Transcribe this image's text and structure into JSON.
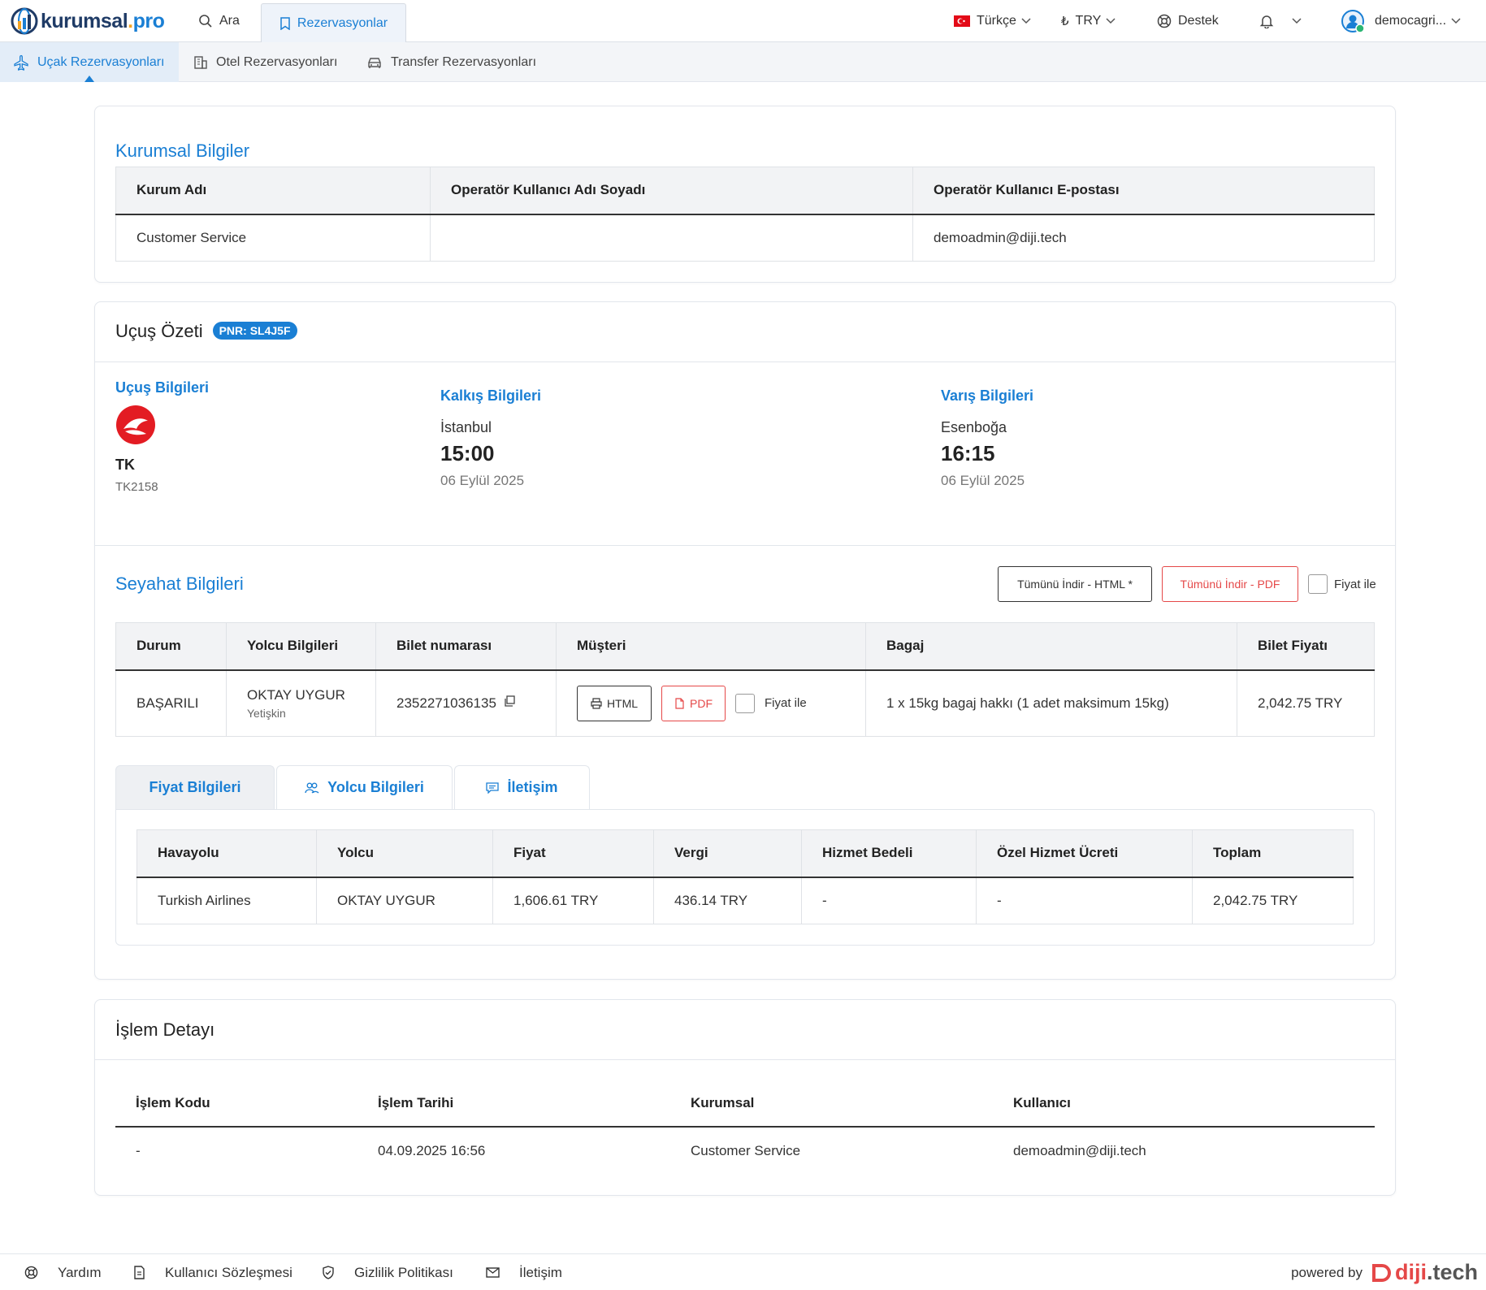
{
  "brand": {
    "name_part1": "kurumsal",
    "name_dot": ".",
    "name_part2": "pro"
  },
  "topnav": {
    "search_label": "Ara",
    "reservations_label": "Rezervasyonlar",
    "language_label": "Türkçe",
    "currency_symbol": "₺",
    "currency_label": "TRY",
    "support_label": "Destek",
    "user_label": "democagri..."
  },
  "subnav": {
    "flight": "Uçak Rezervasyonları",
    "hotel": "Otel Rezervasyonları",
    "transfer": "Transfer Rezervasyonları"
  },
  "corporate": {
    "title": "Kurumsal Bilgiler",
    "headers": [
      "Kurum Adı",
      "Operatör Kullanıcı Adı Soyadı",
      "Operatör Kullanıcı E-postası"
    ],
    "row": [
      "Customer Service",
      "",
      "demoadmin@diji.tech"
    ]
  },
  "flight_summary": {
    "title": "Uçuş Özeti",
    "pnr": "PNR: SL4J5F",
    "flight_info_label": "Uçuş Bilgileri",
    "airline_code": "TK",
    "flight_number": "TK2158",
    "departure": {
      "label": "Kalkış Bilgileri",
      "city": "İstanbul",
      "time": "15:00",
      "date": "06 Eylül 2025"
    },
    "arrival": {
      "label": "Varış Bilgileri",
      "city": "Esenboğa",
      "time": "16:15",
      "date": "06 Eylül 2025"
    }
  },
  "travel": {
    "title": "Seyahat Bilgileri",
    "download_html": "Tümünü İndir - HTML *",
    "download_pdf": "Tümünü İndir - PDF",
    "with_price": "Fiyat ile",
    "headers": [
      "Durum",
      "Yolcu Bilgileri",
      "Bilet numarası",
      "Müşteri",
      "Bagaj",
      "Bilet Fiyatı"
    ],
    "row": {
      "status": "BAŞARILI",
      "passenger": "OKTAY UYGUR",
      "passenger_type": "Yetişkin",
      "ticket_no": "2352271036135",
      "btn_html": "HTML",
      "btn_pdf": "PDF",
      "with_price": "Fiyat ile",
      "baggage": "1 x 15kg bagaj hakkı (1 adet maksimum 15kg)",
      "price": "2,042.75 TRY"
    }
  },
  "tabs": {
    "price": "Fiyat Bilgileri",
    "passenger": "Yolcu Bilgileri",
    "contact": "İletişim"
  },
  "price_table": {
    "headers": [
      "Havayolu",
      "Yolcu",
      "Fiyat",
      "Vergi",
      "Hizmet Bedeli",
      "Özel Hizmet Ücreti",
      "Toplam"
    ],
    "row": [
      "Turkish Airlines",
      "OKTAY UYGUR",
      "1,606.61 TRY",
      "436.14 TRY",
      "-",
      "-",
      "2,042.75 TRY"
    ]
  },
  "transaction": {
    "title": "İşlem Detayı",
    "headers": [
      "İşlem Kodu",
      "İşlem Tarihi",
      "Kurumsal",
      "Kullanıcı"
    ],
    "row": [
      "-",
      "04.09.2025 16:56",
      "Customer Service",
      "demoadmin@diji.tech"
    ]
  },
  "footer": {
    "help": "Yardım",
    "terms": "Kullanıcı Sözleşmesi",
    "privacy": "Gizlilik Politikası",
    "contact": "İletişim",
    "powered_by": "powered by",
    "powered_brand_main": "diji",
    "powered_brand_tail": ".tech"
  },
  "colors": {
    "accent": "#1a7fd4",
    "danger": "#e54848",
    "brand_dark": "#1f3b66",
    "brand_orange": "#f5a524"
  }
}
